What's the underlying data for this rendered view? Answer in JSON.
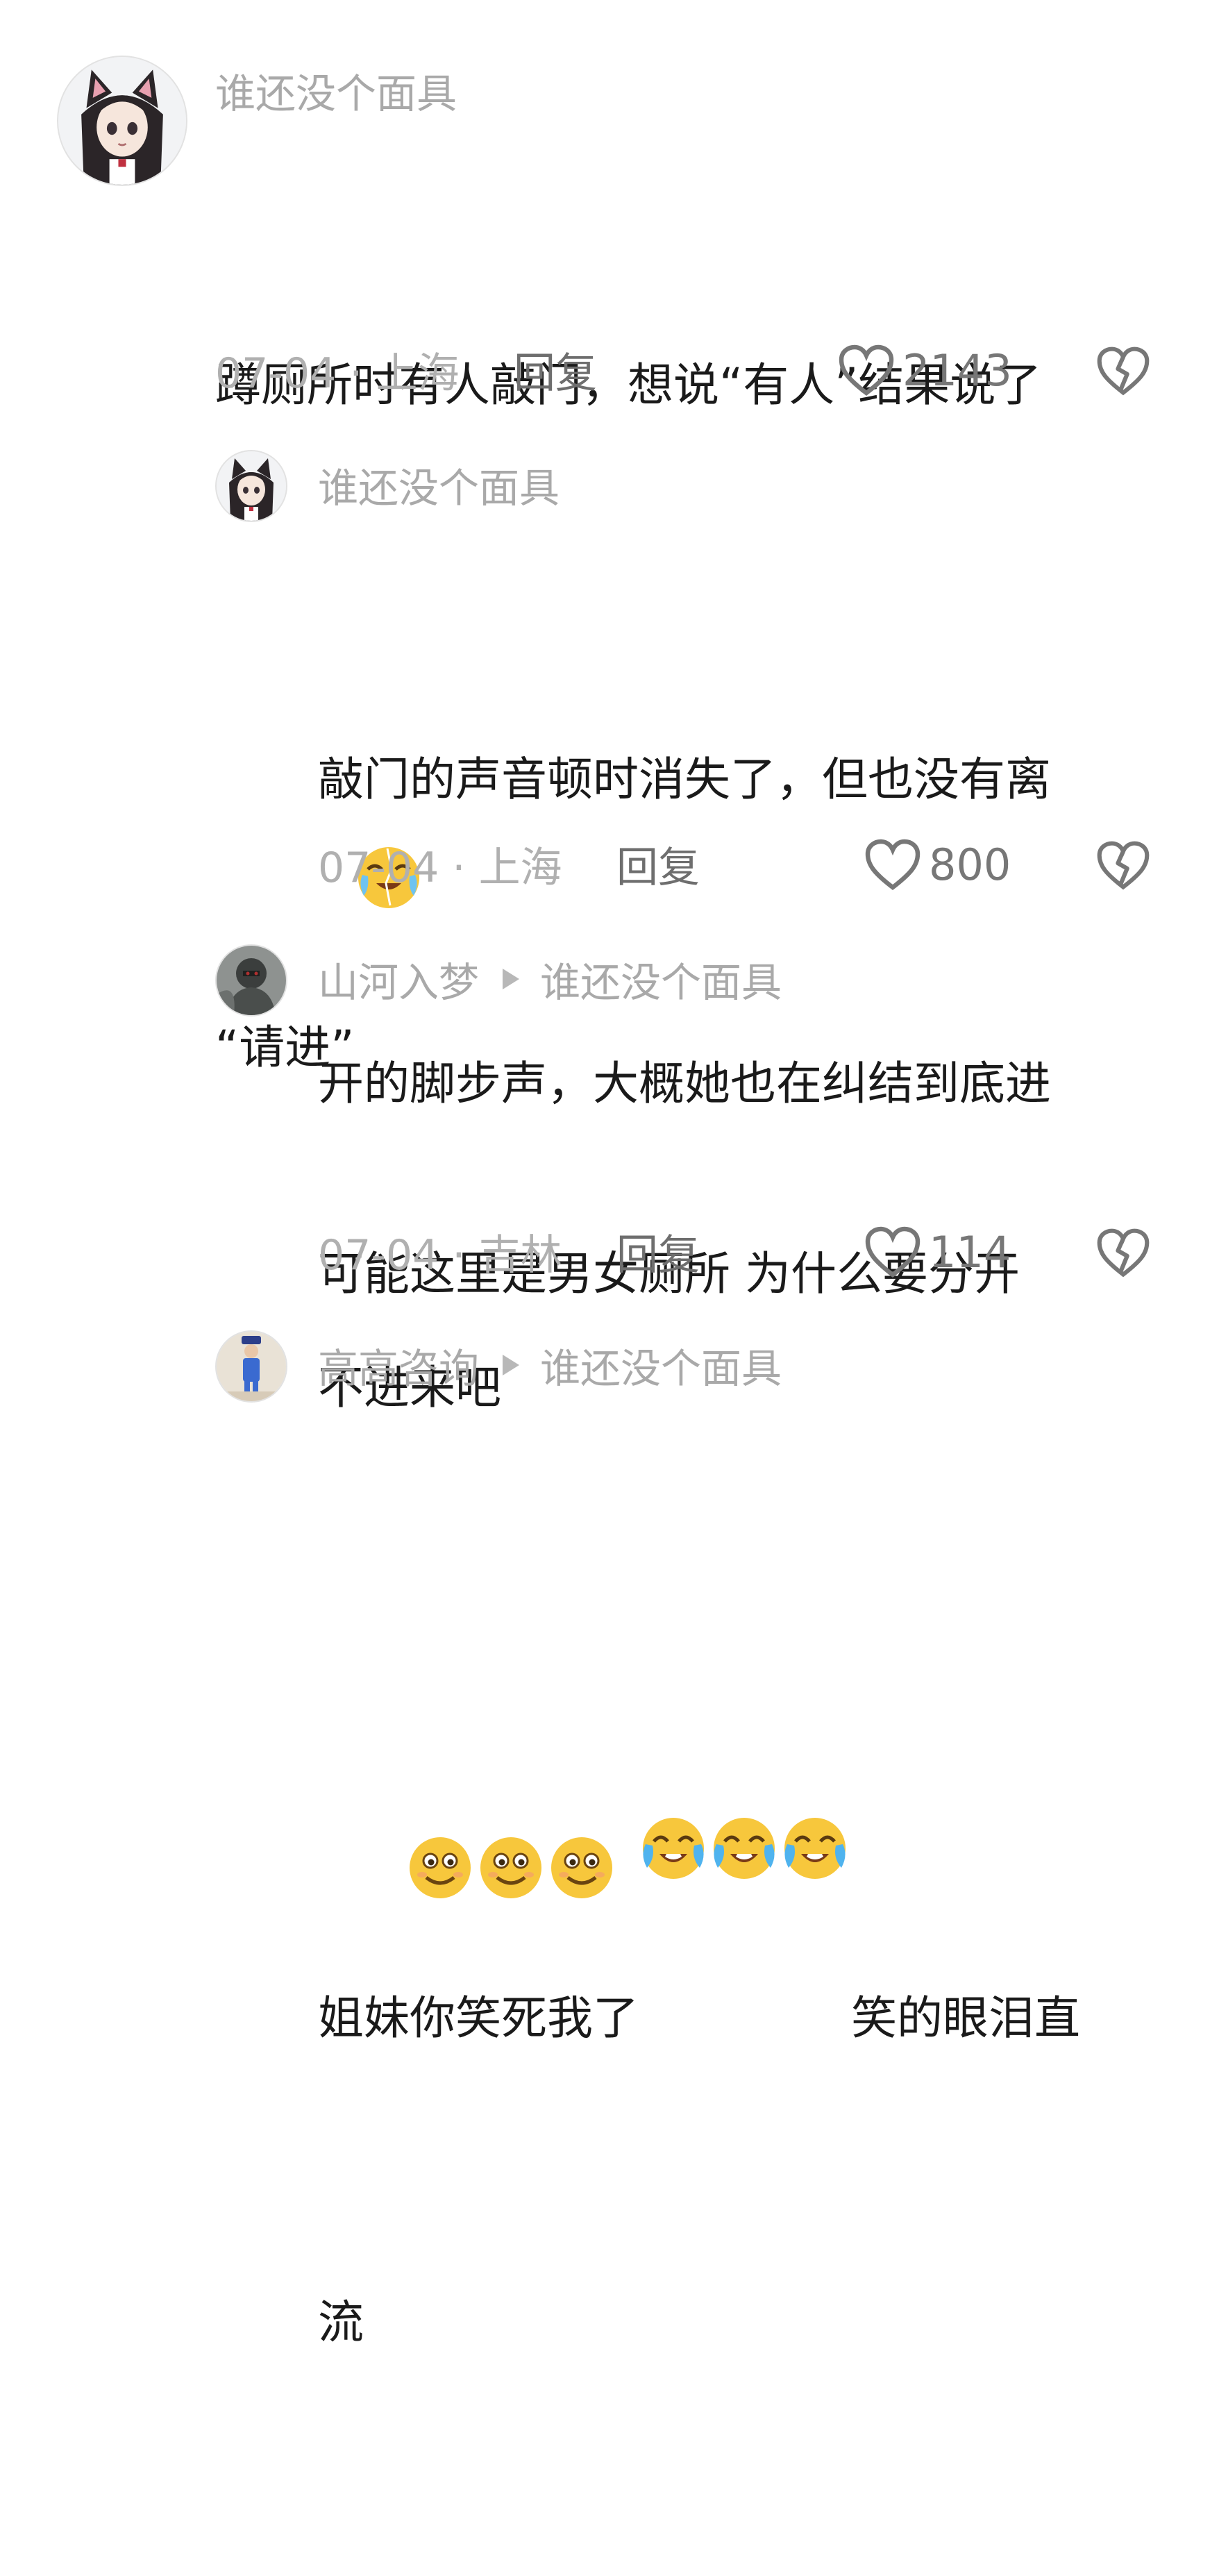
{
  "comments": [
    {
      "author": "谁还没个面具",
      "text_a": "蹲厕所时有人敲门，想说“有人”结果说了",
      "text_b": "“请进”",
      "date_location": "07-04 · 上海",
      "reply_label": "回复",
      "likes": "2143",
      "emoji": "crying-laughing-emoji"
    },
    {
      "author": "谁还没个面具",
      "text_a": "敲门的声音顿时消失了，但也没有离",
      "text_b": "开的脚步声，大概她也在纠结到底进",
      "text_c": "不进来吧",
      "date_location": "07-04 · 上海",
      "reply_label": "回复",
      "likes": "800"
    },
    {
      "author": "山河入梦",
      "reply_to": "谁还没个面具",
      "text_a": "可能这里是男女厕所 为什么要分开",
      "date_location": "07-04 · 吉林",
      "reply_label": "回复",
      "likes": "114",
      "emoji": "smile-emoji"
    },
    {
      "author": "高高咨询",
      "reply_to": "谁还没个面具",
      "text_a_before": "姐妹你笑死我了",
      "text_a_after": "笑的眼泪直",
      "text_b": "流",
      "emoji": "tears-of-joy-emoji"
    }
  ],
  "colors": {
    "name": "#a9a9a9",
    "text": "#1a1a1a",
    "meta": "#b0b0b0",
    "reply": "#6e6e6e",
    "icon": "#777777",
    "emoji_yellow": "#f7c73c"
  }
}
